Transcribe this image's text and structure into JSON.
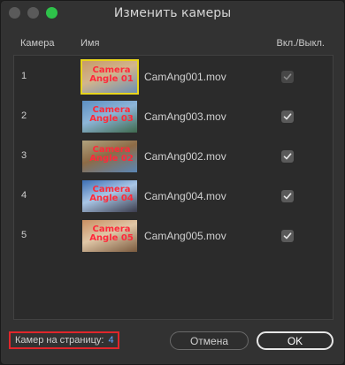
{
  "window": {
    "title": "Изменить камеры"
  },
  "columns": {
    "camera": "Камера",
    "name": "Имя",
    "onoff": "Вкл./Выкл."
  },
  "cameras": [
    {
      "num": "1",
      "file": "CamAng001.mov",
      "thumb_label": "Camera Angle 01",
      "checked": true,
      "selected": true,
      "thumb_colors": [
        "#c79a6a",
        "#d2b58d",
        "#6d8fb1"
      ]
    },
    {
      "num": "2",
      "file": "CamAng003.mov",
      "thumb_label": "Camera Angle 03",
      "checked": true,
      "selected": false,
      "thumb_colors": [
        "#5d8fc1",
        "#8db5d8",
        "#3f6a4e"
      ]
    },
    {
      "num": "3",
      "file": "CamAng002.mov",
      "thumb_label": "Camera Angle 02",
      "checked": true,
      "selected": false,
      "thumb_colors": [
        "#b0a27e",
        "#8d6b46",
        "#5a86b5"
      ]
    },
    {
      "num": "4",
      "file": "CamAng004.mov",
      "thumb_label": "Camera Angle 04",
      "checked": true,
      "selected": false,
      "thumb_colors": [
        "#3c6fb4",
        "#a9c6e6",
        "#3b3b4b"
      ]
    },
    {
      "num": "5",
      "file": "CamAng005.mov",
      "thumb_label": "Camera Angle 05",
      "checked": true,
      "selected": false,
      "thumb_colors": [
        "#c98f62",
        "#e0c7a7",
        "#7a5a3e"
      ]
    }
  ],
  "footer": {
    "per_page_label": "Камер на страницу:",
    "per_page_value": "4",
    "cancel_label": "Отмена",
    "ok_label": "OK"
  },
  "colors": {
    "highlight_border": "#e0262b",
    "selected_thumb": "#e8d51c",
    "value_text": "#5fa3ff",
    "label_red": "#ff2a3a"
  }
}
